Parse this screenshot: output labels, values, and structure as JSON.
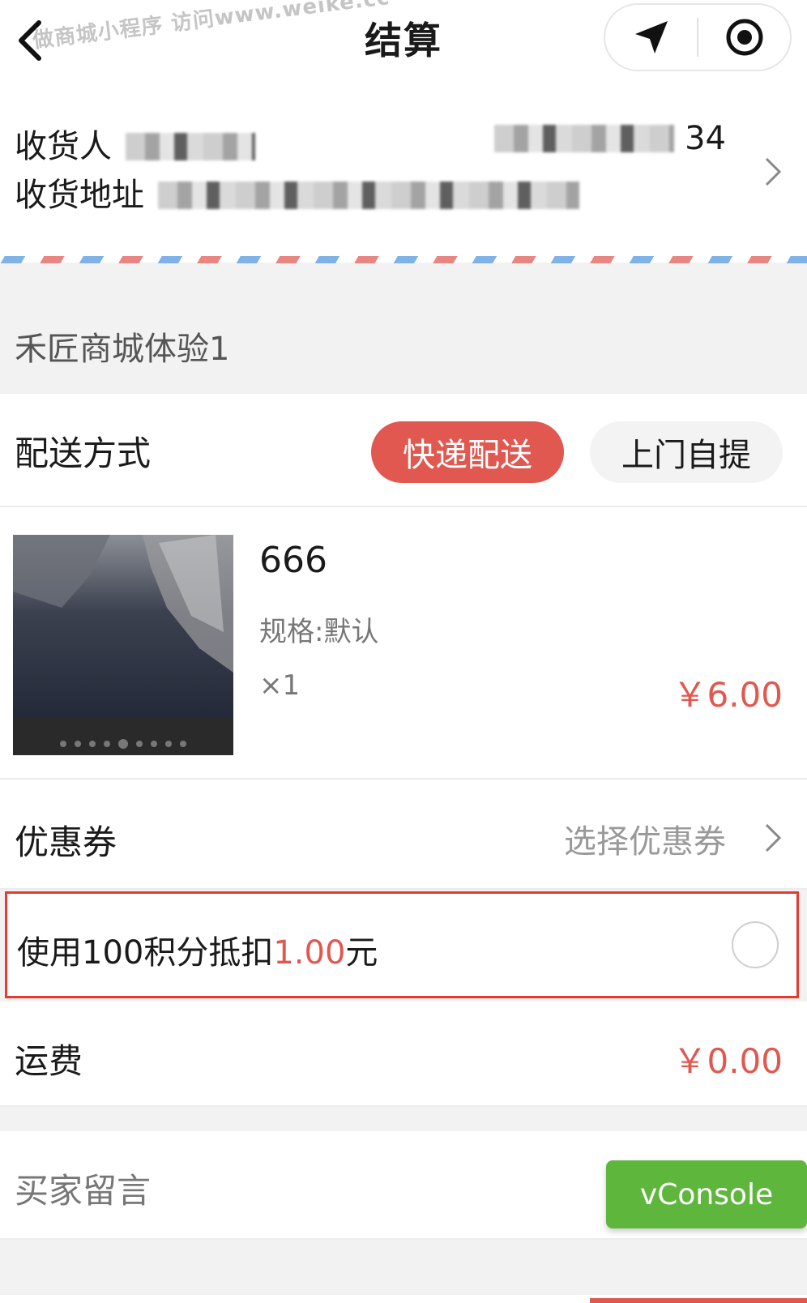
{
  "header": {
    "title": "结算",
    "watermark": "做商城小程序 访问www.weike.cc",
    "icons": [
      "back-icon",
      "location-arrow-icon",
      "record-target-icon"
    ]
  },
  "address": {
    "recipient_label": "收货人",
    "phone_tail": "34",
    "address_label": "收货地址"
  },
  "shop": {
    "name": "禾匠商城体验1"
  },
  "delivery": {
    "label": "配送方式",
    "options": [
      "快递配送",
      "上门自提"
    ],
    "selected": "快递配送"
  },
  "product": {
    "name": "666",
    "spec": "规格:默认",
    "qty": "×1",
    "price": "￥6.00"
  },
  "coupon": {
    "label": "优惠券",
    "value": "选择优惠券"
  },
  "points": {
    "prefix": "使用100积分抵扣",
    "amount": "1.00",
    "suffix": "元",
    "checked": false
  },
  "freight": {
    "label": "运费",
    "value": "￥0.00"
  },
  "remark": {
    "label": "买家留言"
  },
  "vconsole": {
    "label": "vConsole"
  },
  "colors": {
    "accent": "#e0584f",
    "highlight_border": "#e53b2f",
    "vconsole": "#5fb63d"
  }
}
